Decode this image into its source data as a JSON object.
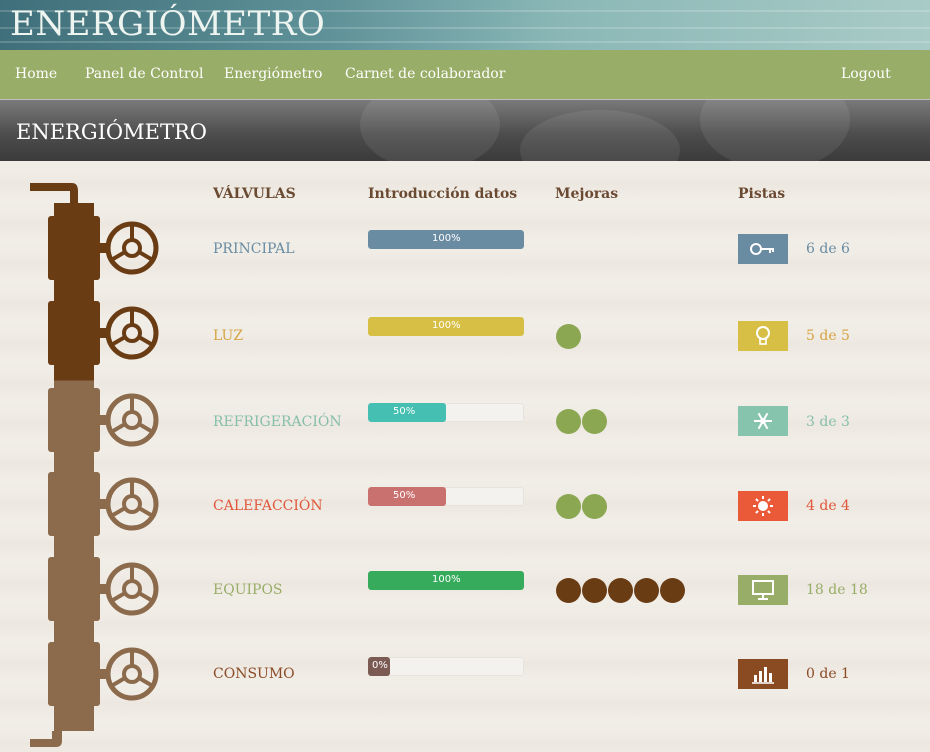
{
  "app": {
    "title": "ENERGIÓMETRO"
  },
  "nav": {
    "items": [
      {
        "label": "Home"
      },
      {
        "label": "Panel de Control"
      },
      {
        "label": "Energiómetro"
      },
      {
        "label": "Carnet de colaborador"
      }
    ],
    "logout": "Logout"
  },
  "page": {
    "title": "ENERGIÓMETRO"
  },
  "columns": {
    "valves": "VÁLVULAS",
    "data_entry": "Introducción datos",
    "improvements": "Mejoras",
    "hints": "Pistas"
  },
  "rows": [
    {
      "label": "PRINCIPAL",
      "color": "#6a8ca3",
      "progress": 100,
      "progress_label": "100%",
      "improvements": 0,
      "dot_color": "#8ba752",
      "hint_icon": "key-icon",
      "hints": "6 de 6"
    },
    {
      "label": "LUZ",
      "color": "#d7bf46",
      "text_color": "#d6a443",
      "progress": 100,
      "progress_label": "100%",
      "improvements": 1,
      "dot_color": "#8ba752",
      "hint_icon": "lightbulb-icon",
      "hints": "5 de 5"
    },
    {
      "label": "REFRIGERACIÓN",
      "color": "#45bfb1",
      "text_color": "#86bfa8",
      "icon_color": "#86c4ae",
      "progress": 50,
      "progress_label": "50%",
      "improvements": 2,
      "dot_color": "#8ba752",
      "hint_icon": "snowflake-icon",
      "hints": "3 de 3"
    },
    {
      "label": "CALEFACCIÓN",
      "color": "#c9716f",
      "text_color": "#e0573a",
      "icon_color": "#ea5a38",
      "progress": 50,
      "progress_label": "50%",
      "improvements": 2,
      "dot_color": "#8ba752",
      "hint_icon": "sun-icon",
      "hints": "4 de 4"
    },
    {
      "label": "EQUIPOS",
      "color": "#35ab5b",
      "text_color": "#98ad67",
      "icon_color": "#98ad67",
      "progress": 100,
      "progress_label": "100%",
      "improvements": 5,
      "dot_color": "#6a3c14",
      "hint_icon": "monitor-icon",
      "hints": "18 de 18"
    },
    {
      "label": "CONSUMO",
      "color": "#7a5a52",
      "text_color": "#8a4a25",
      "icon_color": "#8a4a22",
      "progress": 0,
      "progress_label": "0%",
      "improvements": 0,
      "dot_color": "#6a3c14",
      "hint_icon": "chart-icon",
      "hints": "0 de 1"
    }
  ],
  "gauge": {
    "filled_level": 2,
    "total_levels": 6,
    "filled_color": "#6a3c14",
    "empty_color": "#8c6a4c"
  }
}
